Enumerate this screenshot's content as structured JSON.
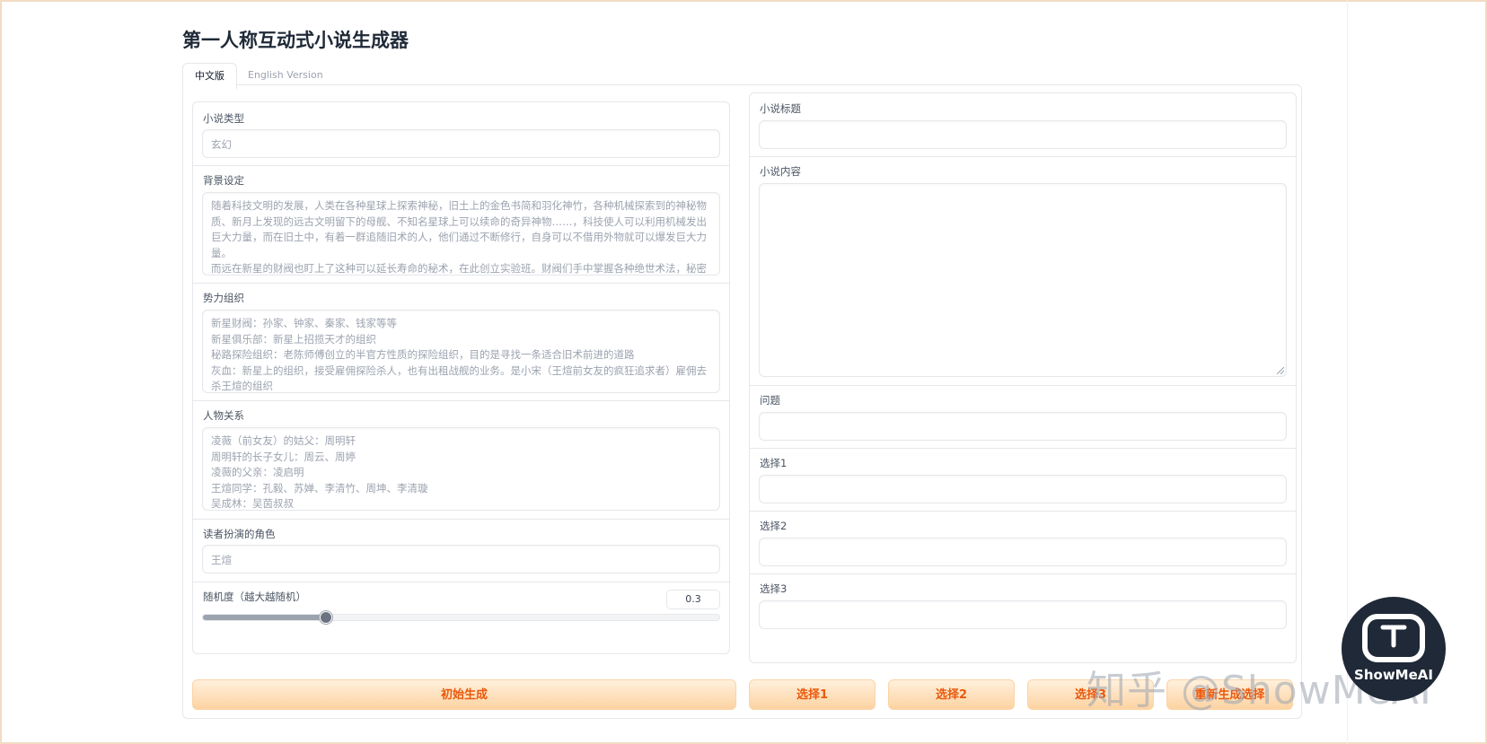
{
  "page": {
    "title": "第一人称互动式小说生成器"
  },
  "tabs": [
    {
      "label": "中文版",
      "active": true
    },
    {
      "label": "English Version",
      "active": false
    }
  ],
  "form": {
    "novel_type": {
      "label": "小说类型",
      "placeholder": "玄幻"
    },
    "background": {
      "label": "背景设定",
      "placeholder": "随着科技文明的发展，人类在各种星球上探索神秘，旧土上的金色书简和羽化神竹，各种机械探索到的神秘物质、新月上发现的远古文明留下的母舰、不知名星球上可以续命的奇异神物……，科技使人可以利用机械发出巨大力量，而在旧土中，有着一群追随旧术的人，他们通过不断修行，自身可以不借用外物就可以爆发巨大力量。\n而远在新星的财阀也盯上了这种可以延长寿命的秘术，在此创立实验班。财阀们手中掌握各种绝世术法，秘密中有着异宝，在这个各种机械存在，飞船可以横渡深空，战舰可以轰杀神仙的年代，到此从大幕中归来"
    },
    "factions": {
      "label": "势力组织",
      "placeholder": "新星财阀：孙家、钟家、秦家、钱家等等\n新星俱乐部：新星上招揽天才的组织\n秘路探险组织：老陈师傅创立的半官方性质的探险组织，目的是寻找一条适合旧术前进的道路\n灰血：新星上的组织，接受雇佣探险杀人，也有出租战舰的业务。是小宋（王煊前女友的疯狂追求者）雇佣去杀王煊的组织\n三大超凡星球：包括帝坛星、羽化星、河洛星"
    },
    "relations": {
      "label": "人物关系",
      "placeholder": "凌薇（前女友）的姑父：周明轩\n周明轩的长子女儿：周云、周婷\n凌薇的父亲：凌启明\n王煊同学：孔毅、苏婵、李清竹、周坤、李清璇\n吴成林：吴茵叔叔\n财阀赵泽峻：赵清菡父亲"
    },
    "role": {
      "label": "读者扮演的角色",
      "placeholder": "王煊"
    },
    "randomness": {
      "label": "随机度（越大越随机）",
      "value": "0.3",
      "min": 0,
      "max": 2,
      "fraction": 0.236
    }
  },
  "output": {
    "title": {
      "label": "小说标题",
      "value": ""
    },
    "content": {
      "label": "小说内容",
      "value": ""
    },
    "question": {
      "label": "问题",
      "value": ""
    },
    "choice1": {
      "label": "选择1",
      "value": ""
    },
    "choice2": {
      "label": "选择2",
      "value": ""
    },
    "choice3": {
      "label": "选择3",
      "value": ""
    }
  },
  "buttons": {
    "generate": "初始生成",
    "choice1": "选择1",
    "choice2": "选择2",
    "choice3": "选择3",
    "regenerate": "重新生成选择"
  },
  "watermark": {
    "text": "知乎 @ShowMeAI",
    "logo_text": "ShowMeAI"
  },
  "colors": {
    "accent": "#ea580c",
    "button_light": "#fff0dc",
    "button_dark": "#fcd3a2",
    "logo_bg": "#1f2937"
  }
}
